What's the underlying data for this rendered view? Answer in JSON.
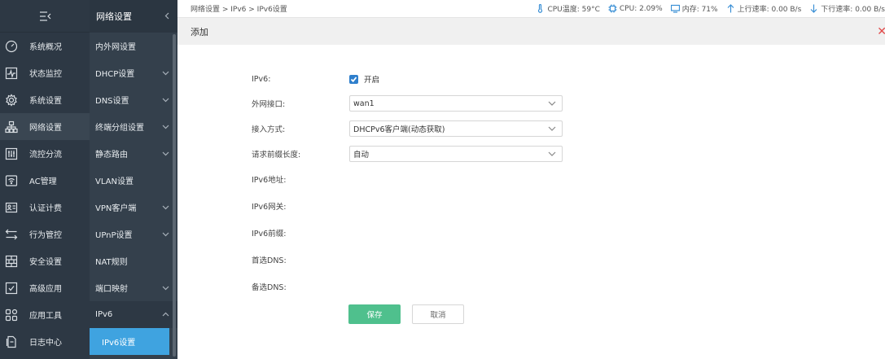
{
  "nav1": {
    "items": [
      {
        "label": "系统概况",
        "icon": "gauge-icon"
      },
      {
        "label": "状态监控",
        "icon": "monitor-pulse-icon"
      },
      {
        "label": "系统设置",
        "icon": "gear-icon"
      },
      {
        "label": "网络设置",
        "icon": "network-icon"
      },
      {
        "label": "流控分流",
        "icon": "sliders-icon"
      },
      {
        "label": "AC管理",
        "icon": "wifi-icon"
      },
      {
        "label": "认证计费",
        "icon": "id-card-icon"
      },
      {
        "label": "行为管控",
        "icon": "arrows-swap-icon"
      },
      {
        "label": "安全设置",
        "icon": "firewall-icon"
      },
      {
        "label": "高级应用",
        "icon": "checklist-icon"
      },
      {
        "label": "应用工具",
        "icon": "apps-grid-icon"
      },
      {
        "label": "日志中心",
        "icon": "log-document-icon"
      }
    ]
  },
  "nav2": {
    "title": "网络设置",
    "items": [
      {
        "label": "内外网设置"
      },
      {
        "label": "DHCP设置"
      },
      {
        "label": "DNS设置"
      },
      {
        "label": "终端分组设置"
      },
      {
        "label": "静态路由"
      },
      {
        "label": "VLAN设置"
      },
      {
        "label": "VPN客户端"
      },
      {
        "label": "UPnP设置"
      },
      {
        "label": "NAT规则"
      },
      {
        "label": "端口映射"
      },
      {
        "label": "IPv6"
      }
    ],
    "sub_active": "IPv6设置"
  },
  "topbar": {
    "breadcrumb": "网络设置 > IPv6 > IPv6设置",
    "cpu_temp": "CPU温度: 59°C",
    "cpu": "CPU: 2.09%",
    "memory": "内存: 71%",
    "upload": "上行速率: 0.00 B/s",
    "download": "下行速率: 0.00 B/s"
  },
  "panel": {
    "title": "添加",
    "close": "✕"
  },
  "form": {
    "ipv6_label": "IPv6:",
    "ipv6_enabled_text": "开启",
    "wan_label": "外网接口:",
    "wan_value": "wan1",
    "access_label": "接入方式:",
    "access_value": "DHCPv6客户端(动态获取)",
    "prefix_len_label": "请求前缀长度:",
    "prefix_len_value": "自动",
    "addr_label": "IPv6地址:",
    "gateway_label": "IPv6网关:",
    "prefix_label": "IPv6前缀:",
    "dns1_label": "首选DNS:",
    "dns2_label": "备选DNS:",
    "save": "保存",
    "cancel": "取消"
  },
  "colors": {
    "nav_bg": "#2d3844",
    "nav2_bg": "#34404c",
    "active_sub": "#3fa3e0",
    "save_btn": "#4fc08d",
    "checkbox": "#2f7fcc",
    "close": "#e24a4a"
  }
}
